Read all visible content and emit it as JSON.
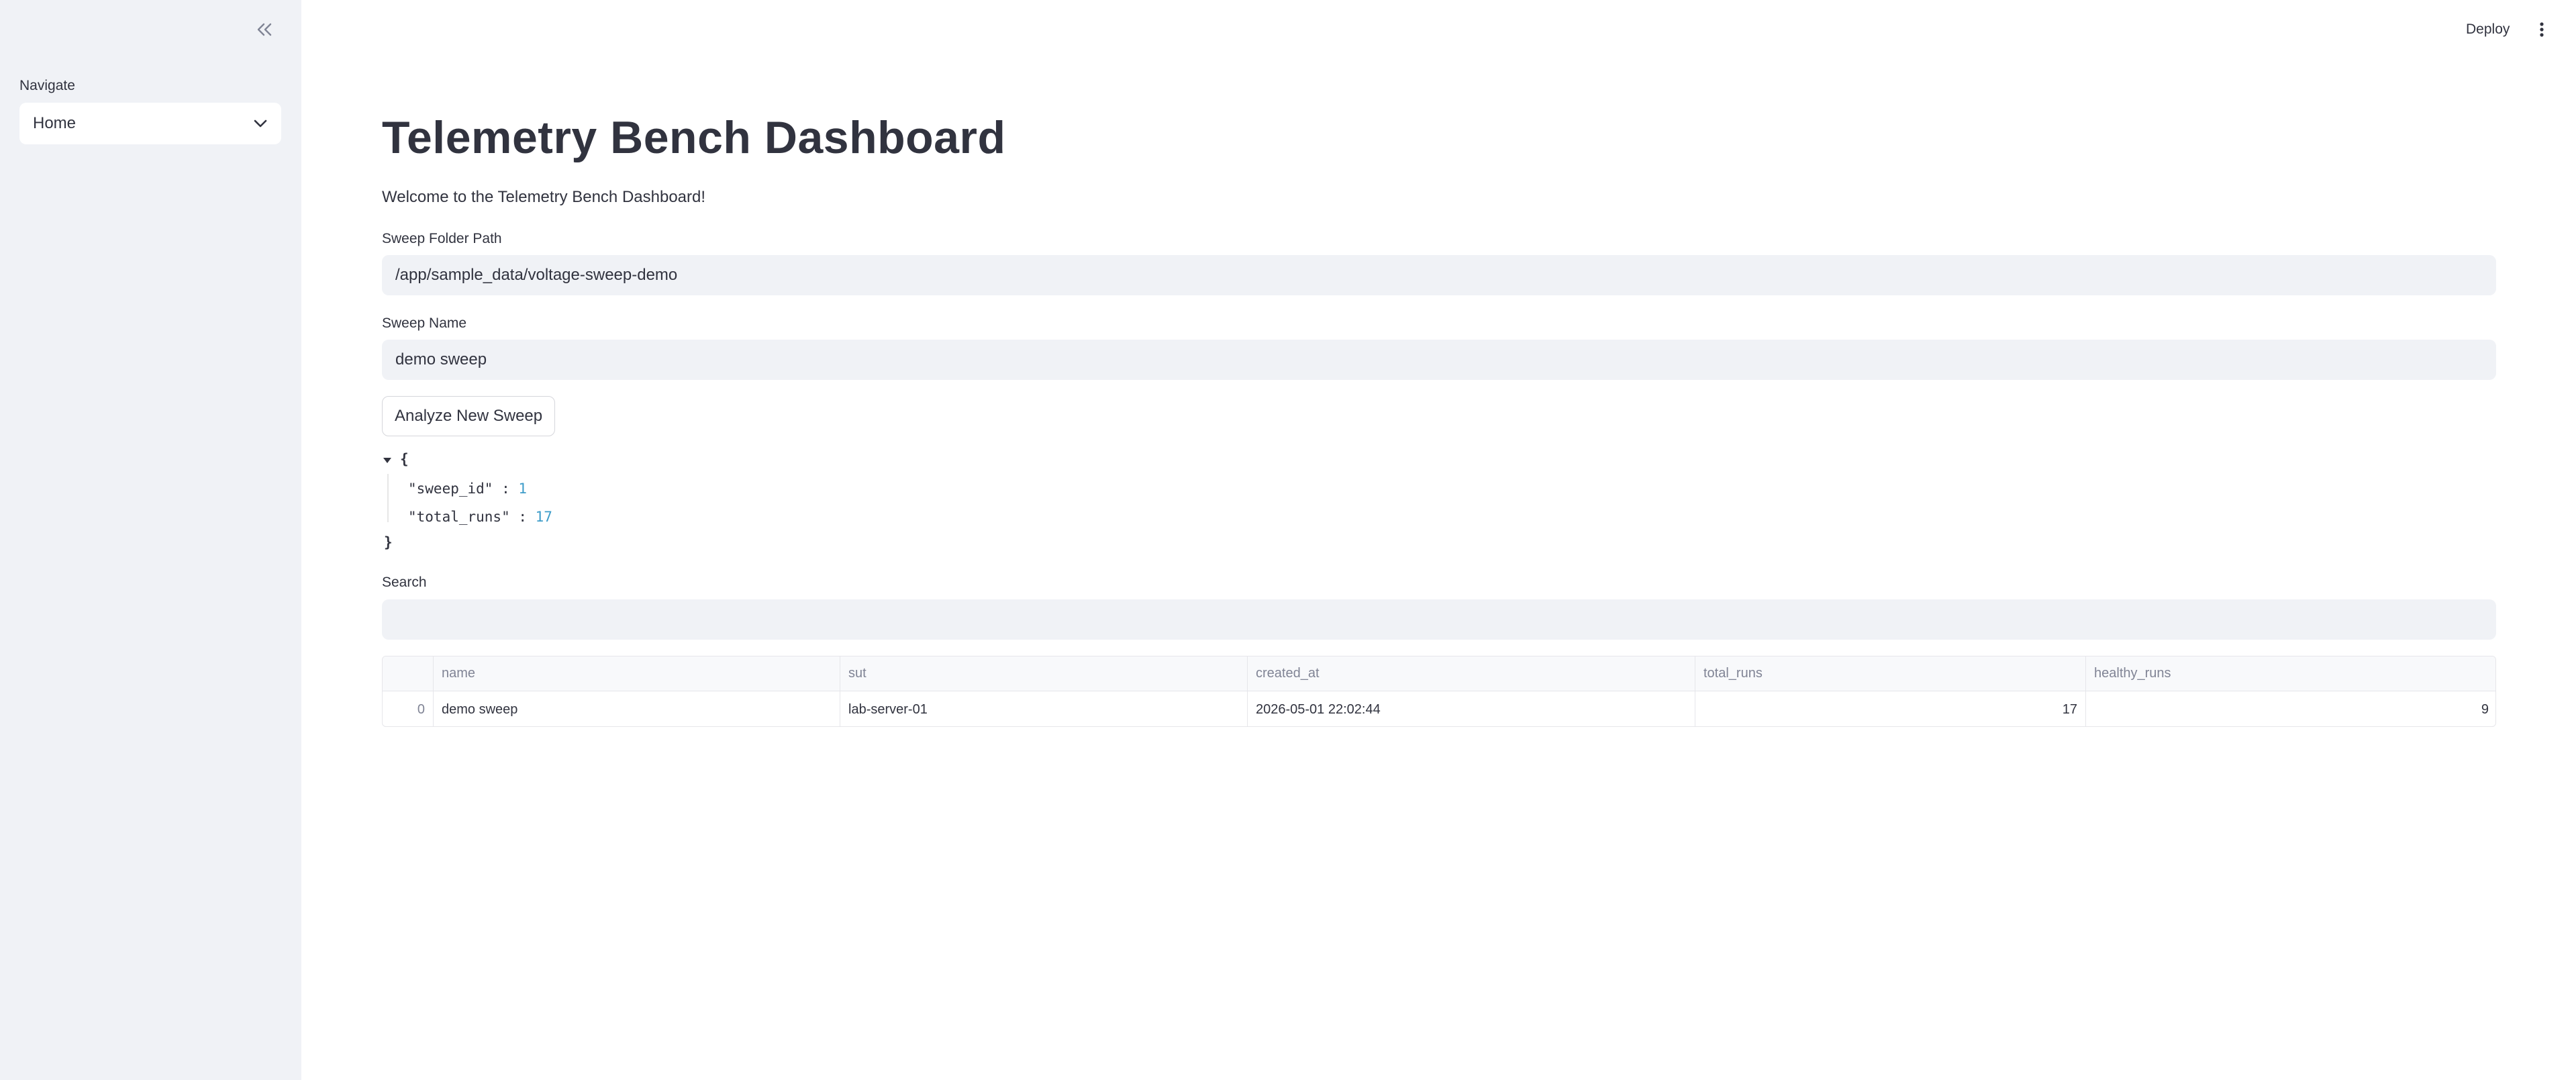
{
  "sidebar": {
    "nav_label": "Navigate",
    "nav_selected": "Home"
  },
  "header": {
    "deploy_label": "Deploy"
  },
  "main": {
    "title": "Telemetry Bench Dashboard",
    "welcome": "Welcome to the Telemetry Bench Dashboard!",
    "sweep_folder": {
      "label": "Sweep Folder Path",
      "value": "/app/sample_data/voltage-sweep-demo"
    },
    "sweep_name": {
      "label": "Sweep Name",
      "value": "demo sweep"
    },
    "analyze_button": "Analyze New Sweep",
    "json_output": {
      "open": "{",
      "close": "}",
      "entries": [
        {
          "key": "\"sweep_id\"",
          "sep": " : ",
          "value": "1"
        },
        {
          "key": "\"total_runs\"",
          "sep": " : ",
          "value": "17"
        }
      ]
    },
    "search": {
      "label": "Search",
      "value": ""
    },
    "table": {
      "columns": [
        "",
        "name",
        "sut",
        "created_at",
        "total_runs",
        "healthy_runs"
      ],
      "rows": [
        [
          "0",
          "demo sweep",
          "lab-server-01",
          "2026-05-01 22:02:44",
          "17",
          "9"
        ]
      ]
    }
  }
}
